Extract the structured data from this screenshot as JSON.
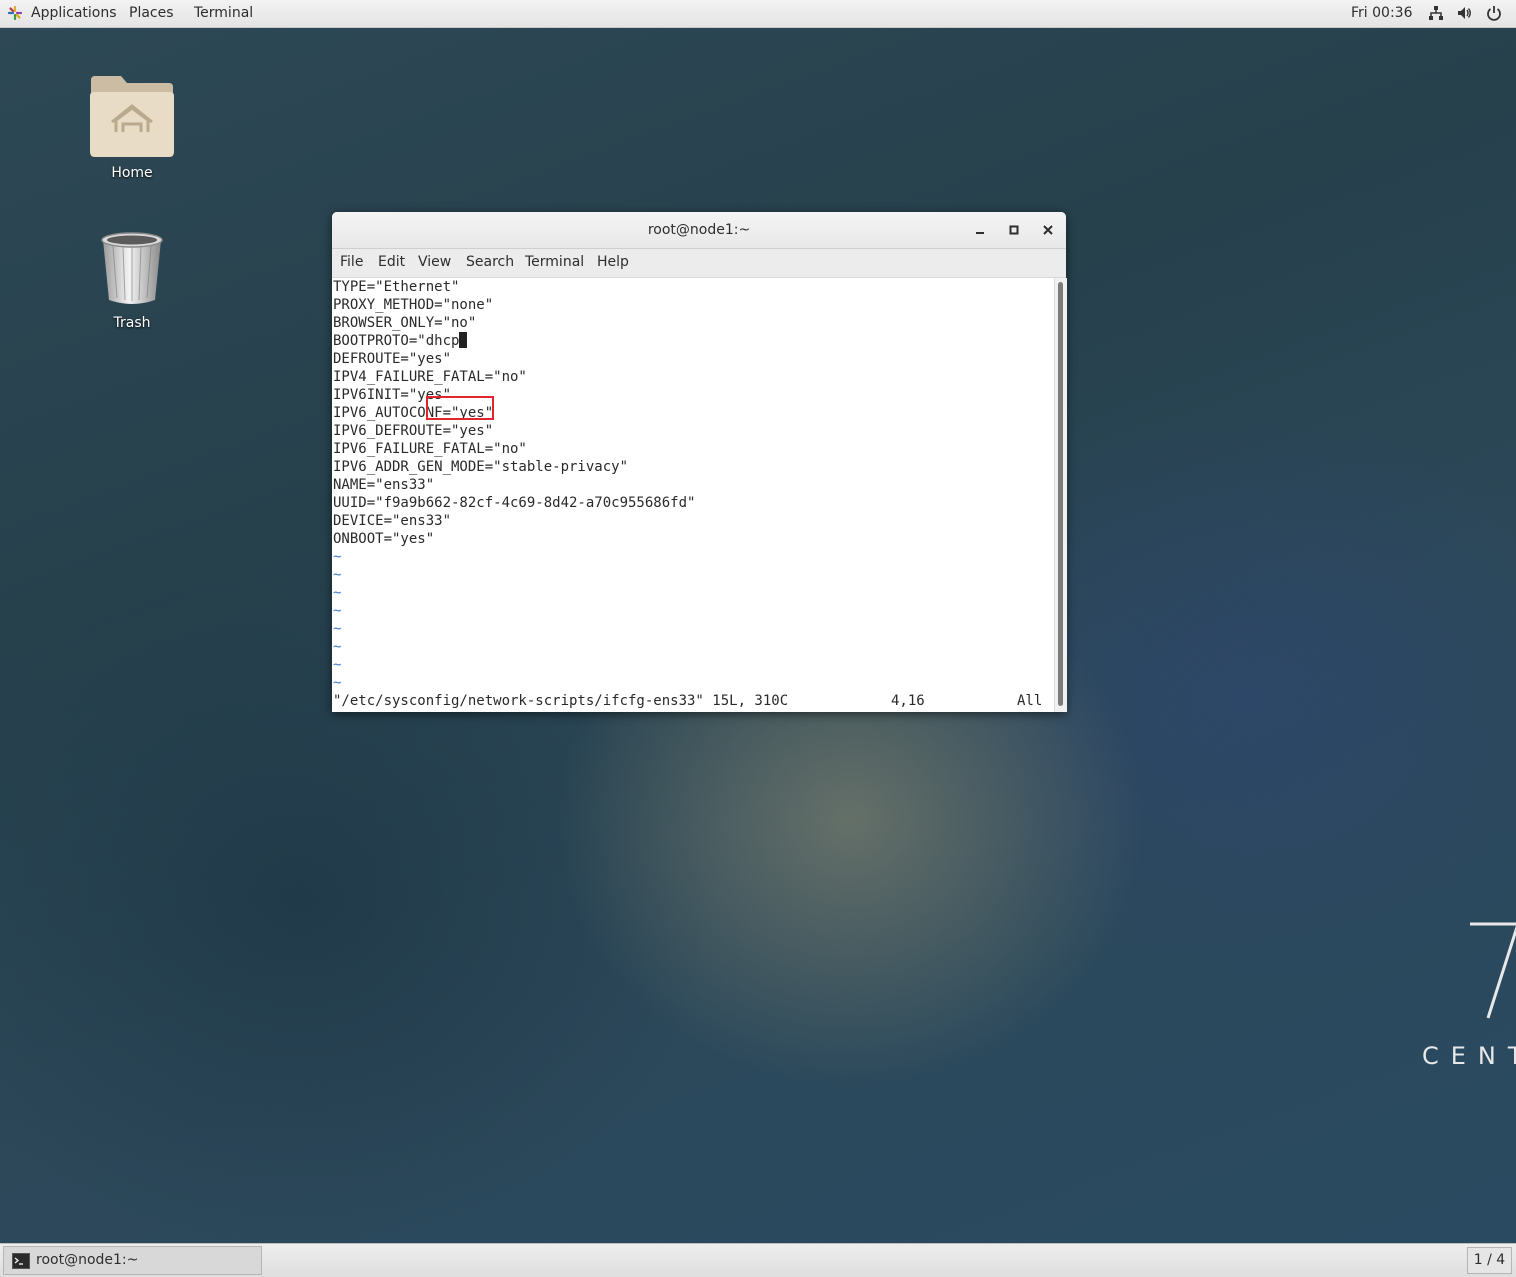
{
  "topbar": {
    "applications": "Applications",
    "places": "Places",
    "terminal": "Terminal",
    "clock": "Fri 00:36"
  },
  "desktop": {
    "home_label": "Home",
    "trash_label": "Trash",
    "brand_text": "CENT"
  },
  "window": {
    "title": "root@node1:~",
    "menu": [
      "File",
      "Edit",
      "View",
      "Search",
      "Terminal",
      "Help"
    ]
  },
  "editor": {
    "lines": [
      "TYPE=\"Ethernet\"",
      "PROXY_METHOD=\"none\"",
      "BROWSER_ONLY=\"no\"",
      "DEFROUTE=\"yes\"",
      "IPV4_FAILURE_FATAL=\"no\"",
      "IPV6INIT=\"yes\"",
      "IPV6_AUTOCONF=\"yes\"",
      "IPV6_DEFROUTE=\"yes\"",
      "IPV6_FAILURE_FATAL=\"no\"",
      "IPV6_ADDR_GEN_MODE=\"stable-privacy\"",
      "NAME=\"ens33\"",
      "UUID=\"f9a9b662-82cf-4c69-8d42-a70c955686fd\"",
      "DEVICE=\"ens33\"",
      "ONBOOT=\"yes\""
    ],
    "bootproto_key": "BOOTPROTO=",
    "bootproto_value": "dhcp",
    "bootproto_quote": "\"",
    "tilde": "~",
    "status_file": "\"/etc/sysconfig/network-scripts/ifcfg-ens33\" 15L, 310C",
    "status_pos": "4,16",
    "status_scroll": "All"
  },
  "taskbar": {
    "task_label": "root@node1:~",
    "workspace": "1 / 4"
  }
}
